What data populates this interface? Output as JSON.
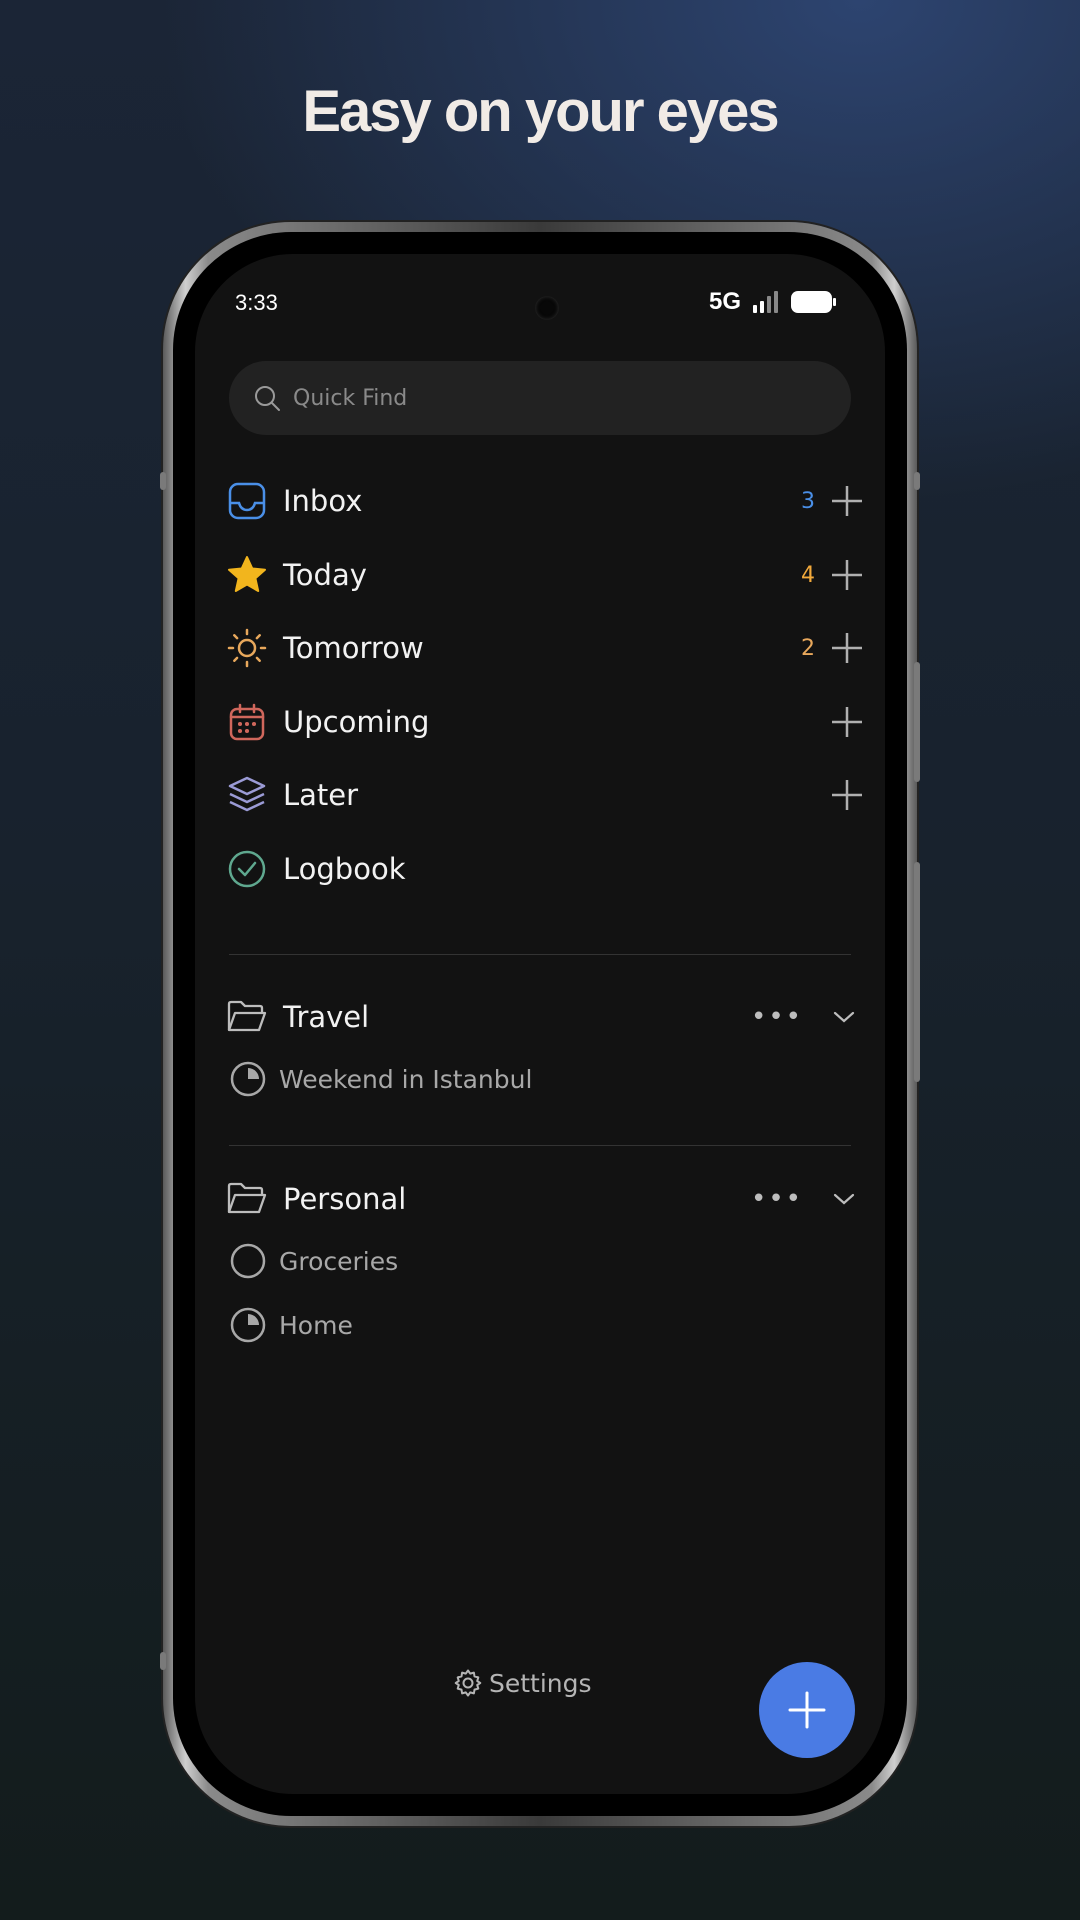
{
  "headline": "Easy on your eyes",
  "status": {
    "time": "3:33",
    "network": "5G"
  },
  "search": {
    "placeholder": "Quick Find"
  },
  "lists": [
    {
      "label": "Inbox",
      "count": "3",
      "icon": "inbox-icon",
      "color": "#4a8fe7"
    },
    {
      "label": "Today",
      "count": "4",
      "icon": "star-icon",
      "color": "#f2b51d"
    },
    {
      "label": "Tomorrow",
      "count": "2",
      "icon": "sun-icon",
      "color": "#e8a85c"
    },
    {
      "label": "Upcoming",
      "count": "",
      "icon": "calendar-icon",
      "color": "#d0675c"
    },
    {
      "label": "Later",
      "count": "",
      "icon": "layers-icon",
      "color": "#9b9bd6"
    },
    {
      "label": "Logbook",
      "count": "",
      "icon": "check-circle-icon",
      "color": "#5fa88f"
    }
  ],
  "groups": [
    {
      "name": "Travel",
      "projects": [
        {
          "label": "Weekend in Istanbul",
          "progress": 0.25
        }
      ]
    },
    {
      "name": "Personal",
      "projects": [
        {
          "label": "Groceries",
          "progress": 0
        },
        {
          "label": "Home",
          "progress": 0.25
        }
      ]
    }
  ],
  "settings_label": "Settings",
  "colors": {
    "accent": "#4a7be4",
    "inbox_count": "#4a8fe7",
    "today_count": "#f2a93b",
    "tomorrow_count": "#e8a85c"
  }
}
